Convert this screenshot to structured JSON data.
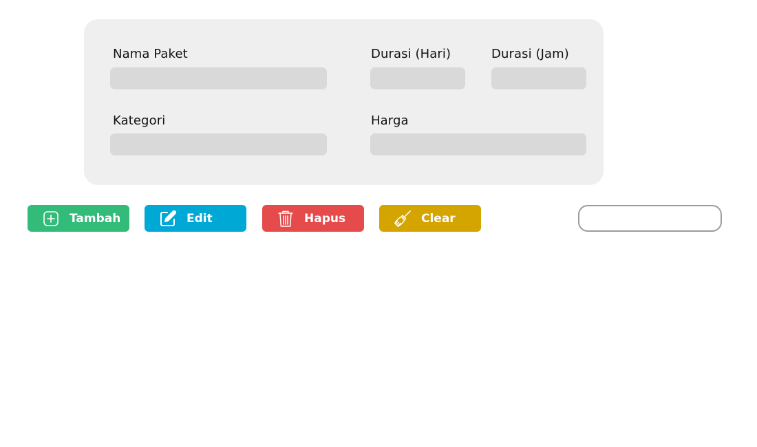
{
  "form": {
    "nama_paket": {
      "label": "Nama Paket",
      "value": "",
      "placeholder": ""
    },
    "durasi_hari": {
      "label": "Durasi (Hari)",
      "value": "",
      "placeholder": ""
    },
    "durasi_jam": {
      "label": "Durasi (Jam)",
      "value": "",
      "placeholder": ""
    },
    "kategori": {
      "label": "Kategori",
      "value": "",
      "placeholder": ""
    },
    "harga": {
      "label": "Harga",
      "value": "",
      "placeholder": ""
    }
  },
  "actions": {
    "add": {
      "label": "Tambah",
      "icon": "plus-square-icon",
      "color": "#33bb7a"
    },
    "edit": {
      "label": "Edit",
      "icon": "edit-icon",
      "color": "#00a8d6"
    },
    "delete": {
      "label": "Hapus",
      "icon": "trash-icon",
      "color": "#e54b4b"
    },
    "clear": {
      "label": "Clear",
      "icon": "broom-icon",
      "color": "#d4a400"
    }
  },
  "search": {
    "value": "",
    "placeholder": ""
  }
}
